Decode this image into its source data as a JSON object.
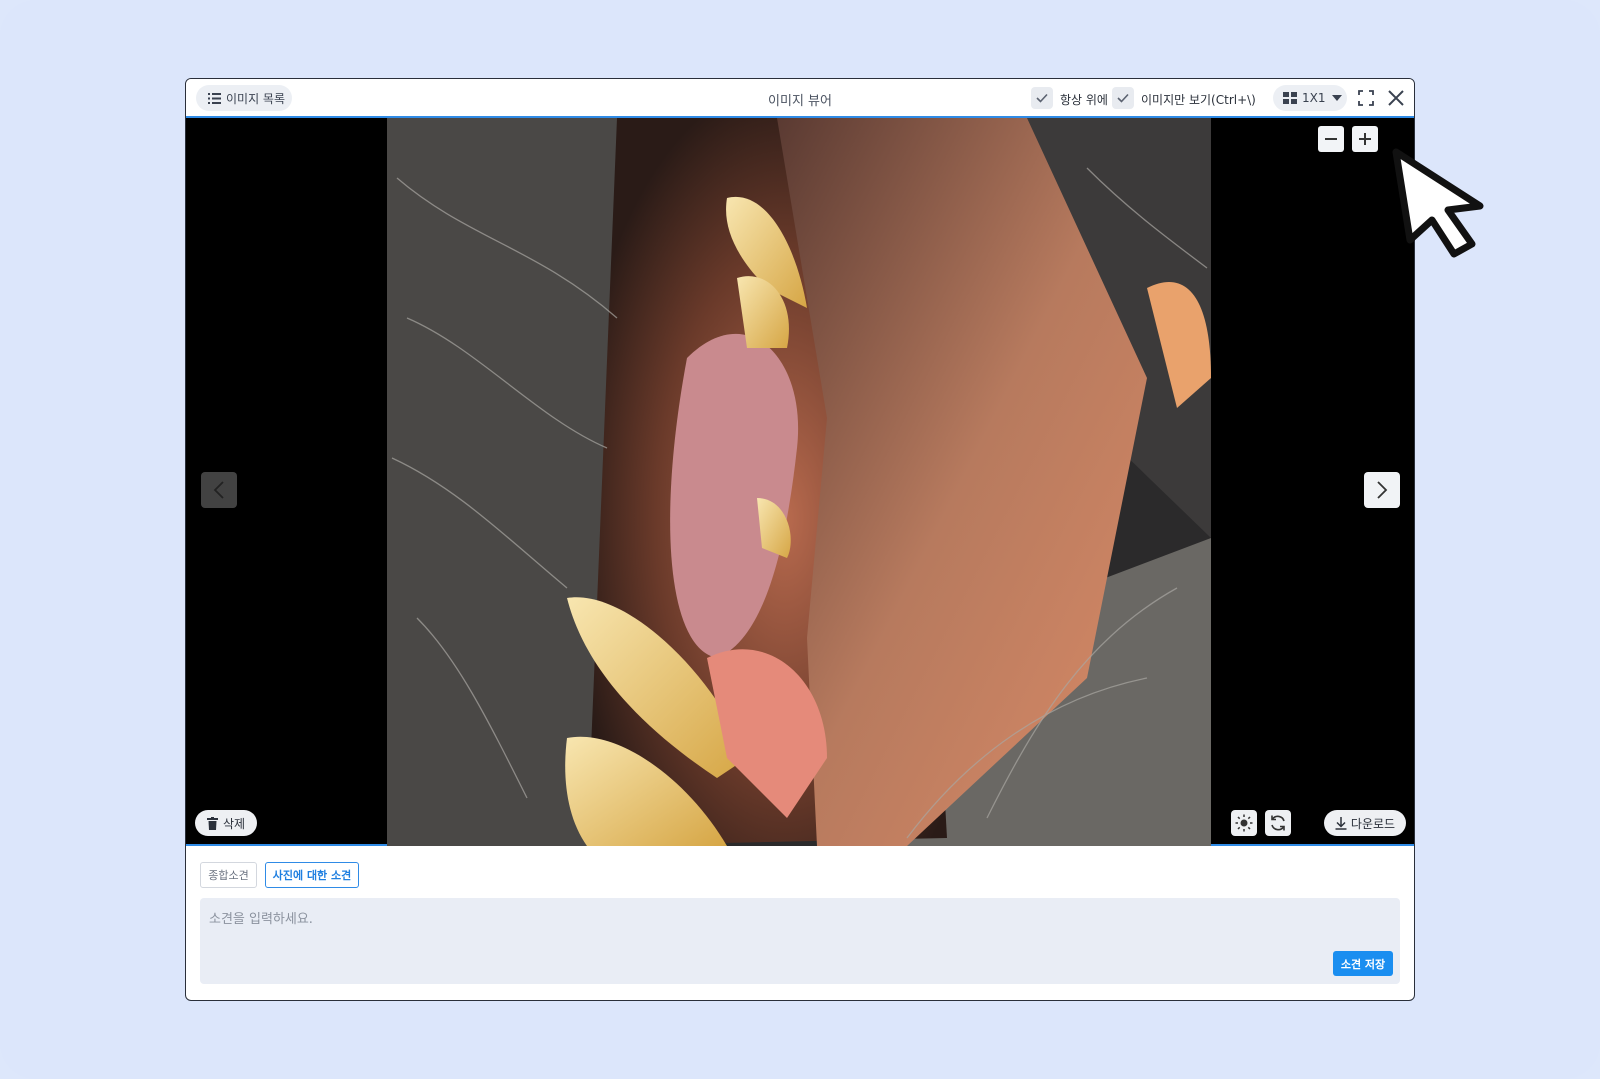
{
  "window": {
    "title": "이미지 뷰어",
    "list_button_label": "이미지 목록",
    "always_on_top_label": "항상 위에",
    "image_only_label": "이미지만 보기(Ctrl+\\)",
    "layout_label": "1X1",
    "layout_options": [
      "1X1"
    ]
  },
  "icons": {
    "list": "list-icon",
    "check": "check-icon",
    "grid": "grid-icon",
    "caret": "caret-down-icon",
    "fullscreen": "fullscreen-icon",
    "close": "close-icon",
    "zoom_out": "minus-icon",
    "zoom_in": "plus-icon",
    "prev": "chevron-left-icon",
    "next": "chevron-right-icon",
    "trash": "trash-icon",
    "brightness": "sun-icon",
    "rotate": "refresh-icon",
    "download": "download-icon",
    "cursor": "mouse-pointer-icon"
  },
  "viewer": {
    "delete_label": "삭제",
    "download_label": "다운로드"
  },
  "memo": {
    "tabs": [
      {
        "label": "종합소견",
        "active": false
      },
      {
        "label": "사진에 대한 소견",
        "active": true
      }
    ],
    "placeholder": "소견을 입력하세요.",
    "value": "",
    "save_label": "소견 저장"
  },
  "colors": {
    "accent": "#2f8be6",
    "save_button": "#1a8ef0",
    "background": "#dde7fb"
  }
}
